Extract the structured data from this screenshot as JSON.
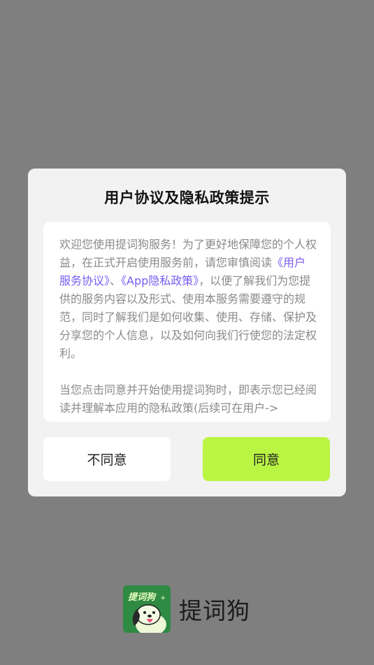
{
  "dialog": {
    "title": "用户协议及隐私政策提示",
    "para1_before": "欢迎您使用提词狗服务！为了更好地保障您的个人权益，在正式开启使用服务前，请您审慎阅读",
    "link_user_agreement": "《用户服务协议》",
    "separator": "、",
    "link_privacy_policy": "《App隐私政策》",
    "para1_after": "，以便了解我们为您提供的服务内容以及形式、使用本服务需要遵守的规范，同时了解我们是如何收集、使用、存储、保护及分享您的个人信息，以及如何向我们行使您的法定权利。",
    "para2": "当您点击同意并开始使用提词狗时，即表示您已经阅读并理解本应用的隐私政策(后续可在用户->",
    "disagree_label": "不同意",
    "agree_label": "同意"
  },
  "brand": {
    "icon_text": "提词狗",
    "name": "提词狗"
  },
  "colors": {
    "overlay": "#7f7f7f",
    "dialog_bg": "#f2f2f2",
    "link": "#7a5cf0",
    "agree_button": "#bbf544",
    "icon_bg": "#2f8a43"
  },
  "icons": {
    "app_icon": "dog-mascot-icon"
  }
}
